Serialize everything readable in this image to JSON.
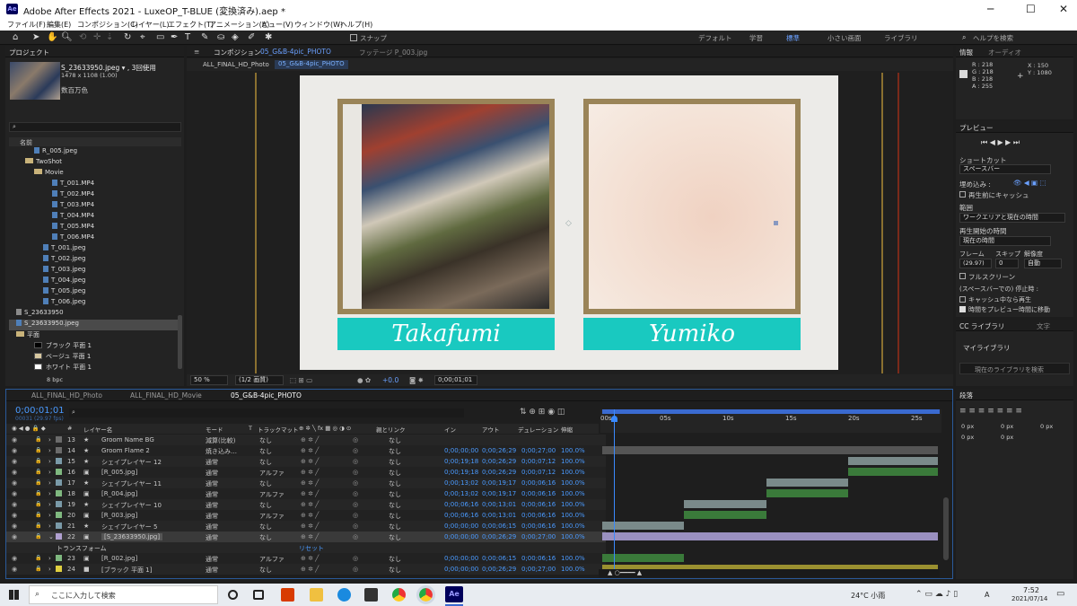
{
  "window": {
    "title": "Adobe After Effects 2021 - LuxeOP_T-BLUE (変換済み).aep *",
    "app_icon": "Ae",
    "min": "─",
    "max": "☐",
    "close": "✕"
  },
  "menu": [
    "ファイル(F)",
    "編集(E)",
    "コンポジション(C)",
    "レイヤー(L)",
    "エフェクト(T)",
    "アニメーション(A)",
    "ビュー(V)",
    "ウィンドウ(W)",
    "ヘルプ(H)"
  ],
  "toolbar": {
    "snap_label": "スナップ",
    "workspaces": [
      "デフォルト",
      "学習",
      "標準",
      "小さい画面",
      "ライブラリ"
    ],
    "search_placeholder": "ヘルプを検索"
  },
  "project": {
    "title": "プロジェクト",
    "thumb_name": "S_23633950.jpeg ▾ , 3回使用",
    "thumb_dims": "1478 x 1108 (1.00)",
    "thumb_color": "数百万色",
    "search_placeholder": "",
    "col_name": "名前",
    "items": [
      {
        "n": "R_005.jpeg",
        "t": "f",
        "i": 2
      },
      {
        "n": "TwoShot",
        "t": "d",
        "i": 1
      },
      {
        "n": "Movie",
        "t": "d",
        "i": 2
      },
      {
        "n": "T_001.MP4",
        "t": "f",
        "i": 4
      },
      {
        "n": "T_002.MP4",
        "t": "f",
        "i": 4
      },
      {
        "n": "T_003.MP4",
        "t": "f",
        "i": 4
      },
      {
        "n": "T_004.MP4",
        "t": "f",
        "i": 4
      },
      {
        "n": "T_005.MP4",
        "t": "f",
        "i": 4
      },
      {
        "n": "T_006.MP4",
        "t": "f",
        "i": 4
      },
      {
        "n": "T_001.jpeg",
        "t": "f",
        "i": 3
      },
      {
        "n": "T_002.jpeg",
        "t": "f",
        "i": 3
      },
      {
        "n": "T_003.jpeg",
        "t": "f",
        "i": 3
      },
      {
        "n": "T_004.jpeg",
        "t": "f",
        "i": 3
      },
      {
        "n": "T_005.jpeg",
        "t": "f",
        "i": 3
      },
      {
        "n": "T_006.jpeg",
        "t": "f",
        "i": 3
      },
      {
        "n": "S_23633950",
        "t": "c",
        "i": 0
      },
      {
        "n": "S_23633950.jpeg",
        "t": "f",
        "i": 0,
        "sel": true
      },
      {
        "n": "平面",
        "t": "d",
        "i": 0
      },
      {
        "n": "ブラック 平面 1",
        "t": "s",
        "i": 2,
        "c": "#000000"
      },
      {
        "n": "ベージュ 平面 1",
        "t": "s",
        "i": 2,
        "c": "#d8c8a0"
      },
      {
        "n": "ホワイト 平面 1",
        "t": "s",
        "i": 2,
        "c": "#ffffff"
      }
    ],
    "bpc": "8 bpc"
  },
  "comp_panel": {
    "tab_comp": "コンポジション",
    "comp_name": "05_G&B-4pic_PHOTO",
    "tab_footage": "フッテージ P_003.jpg",
    "breadcrumbs": [
      "ALL_FINAL_HD_Photo",
      "05_G&B-4pic_PHOTO"
    ],
    "zoom": "50 %",
    "resolution": "(1/2 画質)",
    "exposure": "+0.0",
    "timecode": "0;00;01;01",
    "name_left": "Takafumi",
    "name_right": "Yumiko"
  },
  "info": {
    "tab1": "情報",
    "tab2": "オーディオ",
    "r": "R : 218",
    "g": "G : 218",
    "b": "B : 218",
    "a": "A : 255",
    "x": "X : 150",
    "y": "Y : 1080"
  },
  "preview": {
    "title": "プレビュー",
    "shortcut_label": "ショートカット",
    "shortcut_value": "スペースバー",
    "include_label": "埋め込み :",
    "cache_before": "再生前にキャッシュ",
    "range_label": "範囲",
    "range_value": "ワークエリアと現在の時間",
    "play_from_label": "再生開始の時間",
    "play_from_value": "現在の時間",
    "frame_label": "フレーム",
    "skip_label": "スキップ",
    "res_label": "解像度",
    "frame_value": "(29.97)",
    "skip_value": "0",
    "res_value": "自動",
    "fullscreen": "フルスクリーン",
    "stop_label": "(スペースバーでの) 停止時 :",
    "stop_cache": "キャッシュ中なら再生",
    "stop_move": "時間をプレビュー時間に移動"
  },
  "library": {
    "tab1": "CC ライブラリ",
    "tab2": "文字",
    "my_library": "マイライブラリ",
    "search_placeholder": "現在のライブラリを検索"
  },
  "paragraph": {
    "title": "段落",
    "v1": "0 px",
    "v2": "0 px",
    "v3": "0 px",
    "v4": "0 px",
    "v5": "0 px"
  },
  "timeline": {
    "tabs": [
      "ALL_FINAL_HD_Photo",
      "ALL_FINAL_HD_Movie",
      "05_G&B-4pic_PHOTO"
    ],
    "timecode": "0;00;01;01",
    "frames": "00031 (29.97 fps)",
    "headers": {
      "num": "#",
      "name": "レイヤー名",
      "mode": "モード",
      "t": "T",
      "trackmatte": "トラックマット",
      "parent": "親とリンク",
      "in": "イン",
      "out": "アウト",
      "dur": "デュレーション",
      "stretch": "伸縮"
    },
    "ruler": [
      "00s",
      "05s",
      "10s",
      "15s",
      "20s",
      "25s"
    ],
    "layers": [
      {
        "n": "13",
        "name": "Groom Name BG",
        "mode": "減算(比較)",
        "tm": "なし",
        "parent": "なし",
        "in": "",
        "out": "",
        "dur": "",
        "st": "",
        "lc": "#6b6b6b",
        "ic": "★"
      },
      {
        "n": "14",
        "name": "Groom Flame 2",
        "mode": "焼き込み…",
        "tm": "なし",
        "parent": "なし",
        "in": "0;00;00;00",
        "out": "0;00;26;29",
        "dur": "0;00;27;00",
        "st": "100.0%",
        "lc": "#6b6b6b",
        "ic": "★"
      },
      {
        "n": "15",
        "name": "シェイプレイヤー 12",
        "mode": "通常",
        "tm": "なし",
        "parent": "なし",
        "in": "0;00;19;18",
        "out": "0;00;26;29",
        "dur": "0;00;07;12",
        "st": "100.0%",
        "lc": "#7a9aa8",
        "ic": "★"
      },
      {
        "n": "16",
        "name": "[R_005.jpg]",
        "mode": "通常",
        "tm": "アルファ",
        "parent": "なし",
        "in": "0;00;19;18",
        "out": "0;00;26;29",
        "dur": "0;00;07;12",
        "st": "100.0%",
        "lc": "#7fb87f",
        "ic": "▣"
      },
      {
        "n": "17",
        "name": "シェイプレイヤー 11",
        "mode": "通常",
        "tm": "なし",
        "parent": "なし",
        "in": "0;00;13;02",
        "out": "0;00;19;17",
        "dur": "0;00;06;16",
        "st": "100.0%",
        "lc": "#7a9aa8",
        "ic": "★"
      },
      {
        "n": "18",
        "name": "[R_004.jpg]",
        "mode": "通常",
        "tm": "アルファ",
        "parent": "なし",
        "in": "0;00;13;02",
        "out": "0;00;19;17",
        "dur": "0;00;06;16",
        "st": "100.0%",
        "lc": "#7fb87f",
        "ic": "▣"
      },
      {
        "n": "19",
        "name": "シェイプレイヤー 10",
        "mode": "通常",
        "tm": "なし",
        "parent": "なし",
        "in": "0;00;06;16",
        "out": "0;00;13;01",
        "dur": "0;00;06;16",
        "st": "100.0%",
        "lc": "#7a9aa8",
        "ic": "★"
      },
      {
        "n": "20",
        "name": "[R_003.jpg]",
        "mode": "通常",
        "tm": "アルファ",
        "parent": "なし",
        "in": "0;00;06;16",
        "out": "0;00;13;01",
        "dur": "0;00;06;16",
        "st": "100.0%",
        "lc": "#7fb87f",
        "ic": "▣"
      },
      {
        "n": "21",
        "name": "シェイプレイヤー 5",
        "mode": "通常",
        "tm": "なし",
        "parent": "なし",
        "in": "0;00;00;00",
        "out": "0;00;06;15",
        "dur": "0;00;06;16",
        "st": "100.0%",
        "lc": "#7a9aa8",
        "ic": "★"
      },
      {
        "n": "22",
        "name": "[S_23633950.jpg]",
        "mode": "通常",
        "tm": "なし",
        "parent": "なし",
        "in": "0;00;00;00",
        "out": "0;00;26;29",
        "dur": "0;00;27;00",
        "st": "100.0%",
        "lc": "#b0a0d0",
        "ic": "▣",
        "sel": true
      },
      {
        "n": "",
        "name": "トランスフォーム",
        "mode": "",
        "tm": "",
        "parent": "",
        "in": "",
        "out": "",
        "dur": "",
        "st": "",
        "lc": "",
        "ic": "",
        "sub": true,
        "reset": "リセット"
      },
      {
        "n": "23",
        "name": "[R_002.jpg]",
        "mode": "通常",
        "tm": "アルファ",
        "parent": "なし",
        "in": "0;00;00;00",
        "out": "0;00;06;15",
        "dur": "0;00;06;16",
        "st": "100.0%",
        "lc": "#7fb87f",
        "ic": "▣"
      },
      {
        "n": "24",
        "name": "[ブラック 平面 1]",
        "mode": "通常",
        "tm": "なし",
        "parent": "なし",
        "in": "0;00;00;00",
        "out": "0;00;26;29",
        "dur": "0;00;27;00",
        "st": "100.0%",
        "lc": "#e0d040",
        "ic": "■"
      }
    ]
  },
  "taskbar": {
    "search": "ここに入力して検索",
    "weather": "24°C 小雨",
    "ime": "A",
    "time": "7:52",
    "date": "2021/07/14"
  }
}
